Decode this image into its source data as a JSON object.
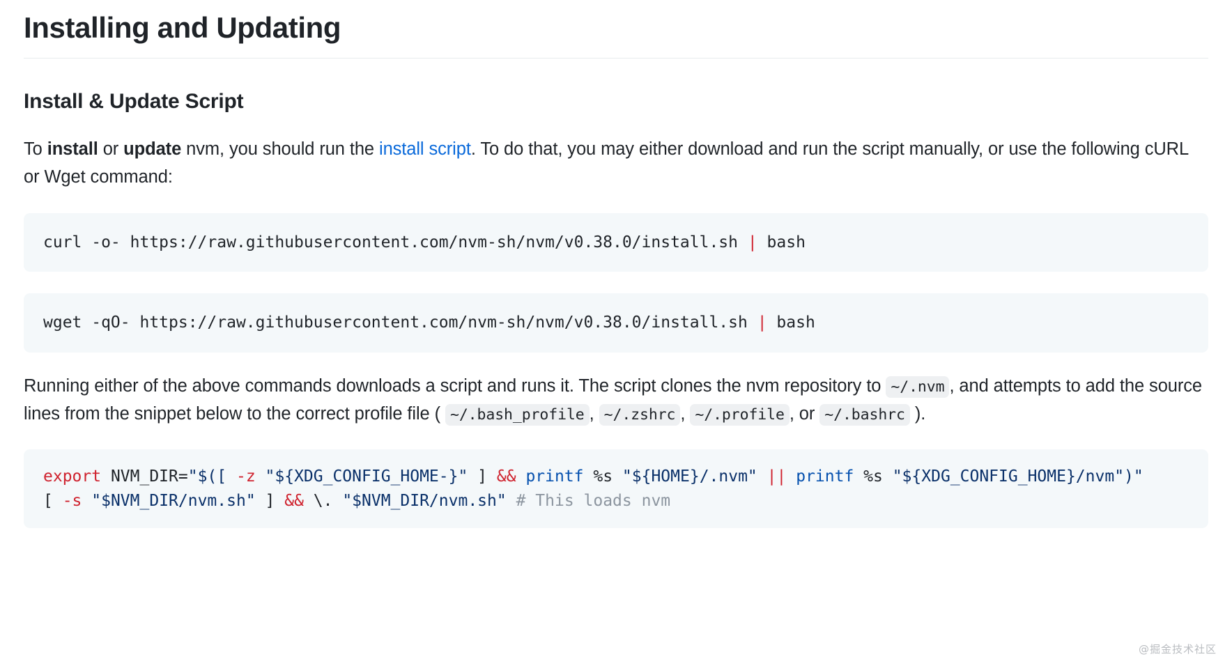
{
  "document": {
    "title": "Installing and Updating",
    "section_heading": "Install & Update Script"
  },
  "intro_paragraph": {
    "part1": "To ",
    "bold1": "install",
    "part2": " or ",
    "bold2": "update",
    "part3": " nvm, you should run the ",
    "link_text": "install script",
    "part4": ". To do that, you may either download and run the script manually, or use the following cURL or Wget command:"
  },
  "code_blocks": [
    {
      "id": "curl-command",
      "segments": [
        {
          "text": "curl -o- https://raw.githubusercontent.com/nvm-sh/nvm/v0.38.0/install.sh ",
          "token": "plain"
        },
        {
          "text": "|",
          "token": "red"
        },
        {
          "text": " bash",
          "token": "plain"
        }
      ]
    },
    {
      "id": "wget-command",
      "segments": [
        {
          "text": "wget -qO- https://raw.githubusercontent.com/nvm-sh/nvm/v0.38.0/install.sh ",
          "token": "plain"
        },
        {
          "text": "|",
          "token": "red"
        },
        {
          "text": " bash",
          "token": "plain"
        }
      ]
    }
  ],
  "running_paragraph": {
    "part1": "Running either of the above commands downloads a script and runs it. The script clones the nvm repository to ",
    "code1": "~/.nvm",
    "part2": ", and attempts to add the source lines from the snippet below to the correct profile file ( ",
    "code2": "~/.bash_profile",
    "part3": ", ",
    "code3": "~/.zshrc",
    "part4": ", ",
    "code4": "~/.profile",
    "part5": ", or ",
    "code5": "~/.bashrc",
    "part6": " )."
  },
  "snippet_block": {
    "id": "nvm-profile-snippet",
    "lines": [
      [
        {
          "text": "export",
          "token": "red"
        },
        {
          "text": " NVM_DIR=",
          "token": "plain"
        },
        {
          "text": "\"$([ ",
          "token": "str"
        },
        {
          "text": "-z",
          "token": "red"
        },
        {
          "text": " ",
          "token": "plain"
        },
        {
          "text": "\"${XDG_CONFIG_HOME-}\"",
          "token": "str"
        },
        {
          "text": " ] ",
          "token": "plain"
        },
        {
          "text": "&&",
          "token": "red"
        },
        {
          "text": " ",
          "token": "plain"
        },
        {
          "text": "printf",
          "token": "blue"
        },
        {
          "text": " %s ",
          "token": "plain"
        },
        {
          "text": "\"${HOME}/.nvm\"",
          "token": "str"
        },
        {
          "text": " ",
          "token": "plain"
        },
        {
          "text": "||",
          "token": "red"
        },
        {
          "text": " ",
          "token": "plain"
        },
        {
          "text": "printf",
          "token": "blue"
        },
        {
          "text": " %s ",
          "token": "plain"
        },
        {
          "text": "\"${XDG_CONFIG_HOME}/nvm\")\"",
          "token": "str"
        }
      ],
      [
        {
          "text": "[ ",
          "token": "plain"
        },
        {
          "text": "-s",
          "token": "red"
        },
        {
          "text": " ",
          "token": "plain"
        },
        {
          "text": "\"$NVM_DIR/nvm.sh\"",
          "token": "str"
        },
        {
          "text": " ] ",
          "token": "plain"
        },
        {
          "text": "&&",
          "token": "red"
        },
        {
          "text": " \\. ",
          "token": "plain"
        },
        {
          "text": "\"$NVM_DIR/nvm.sh\"",
          "token": "str"
        },
        {
          "text": " ",
          "token": "plain"
        },
        {
          "text": "# This loads nvm",
          "token": "cmt"
        }
      ]
    ]
  },
  "watermark": {
    "text": "@掘金技术社区"
  },
  "colors": {
    "link": "#0969da",
    "code_bg": "#f4f8fa",
    "inline_code_bg": "#eef0f2",
    "text": "#1f2328",
    "keyword_red": "#cf222e",
    "function_blue": "#0550ae",
    "string_navy": "#0a3069",
    "comment_gray": "#8c959f"
  }
}
